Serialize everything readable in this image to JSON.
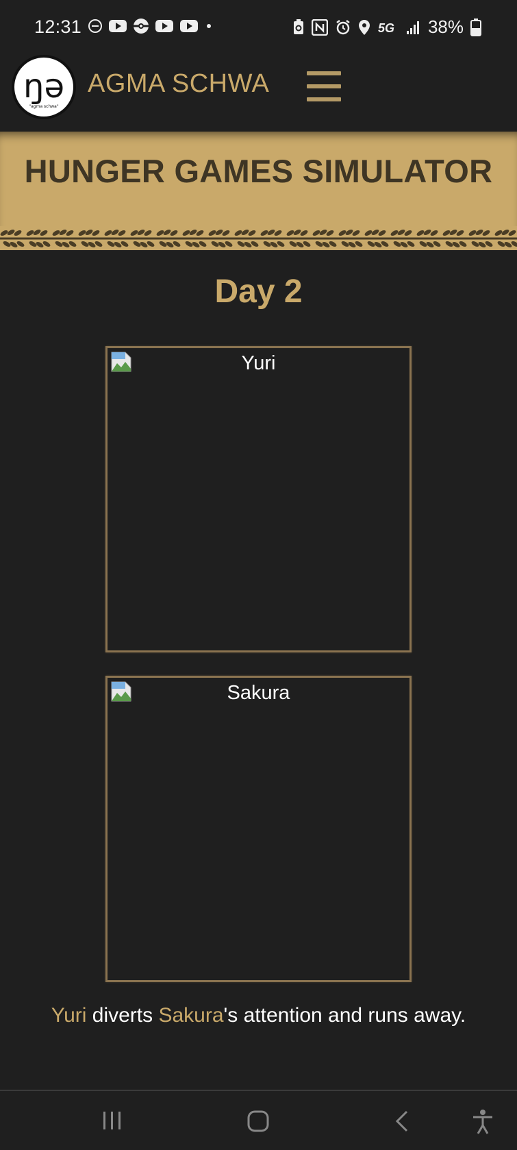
{
  "status_bar": {
    "time": "12:31",
    "left_icons": [
      "do-not-disturb-icon",
      "youtube-icon",
      "pokeball-icon",
      "youtube-icon",
      "youtube-icon",
      "dot-icon"
    ],
    "right_icons": [
      "battery-saver-icon",
      "nfc-icon",
      "alarm-icon",
      "location-icon",
      "5g-icon",
      "signal-icon"
    ],
    "battery_percent": "38%"
  },
  "navbar": {
    "logo_glyph": "ŋə",
    "logo_sub": "\"agma schwa\"",
    "site_name": "AGMA SCHWA",
    "menu_icon": "hamburger-icon"
  },
  "banner": {
    "title": "HUNGER GAMES SIMULATOR"
  },
  "main": {
    "day_title": "Day 2",
    "tributes": [
      {
        "alt": "Yuri"
      },
      {
        "alt": "Sakura"
      }
    ],
    "event": {
      "actor": "Yuri",
      "text_1": " diverts ",
      "target": "Sakura",
      "text_2": "'s attention and runs away."
    }
  },
  "android_nav": {
    "buttons": [
      "recents-icon",
      "home-icon",
      "back-icon",
      "accessibility-icon"
    ]
  },
  "colors": {
    "background": "#1f1f1f",
    "gold": "#c9a96a",
    "dark_gold_text": "#3e3524",
    "frame_border": "#8a7350"
  }
}
